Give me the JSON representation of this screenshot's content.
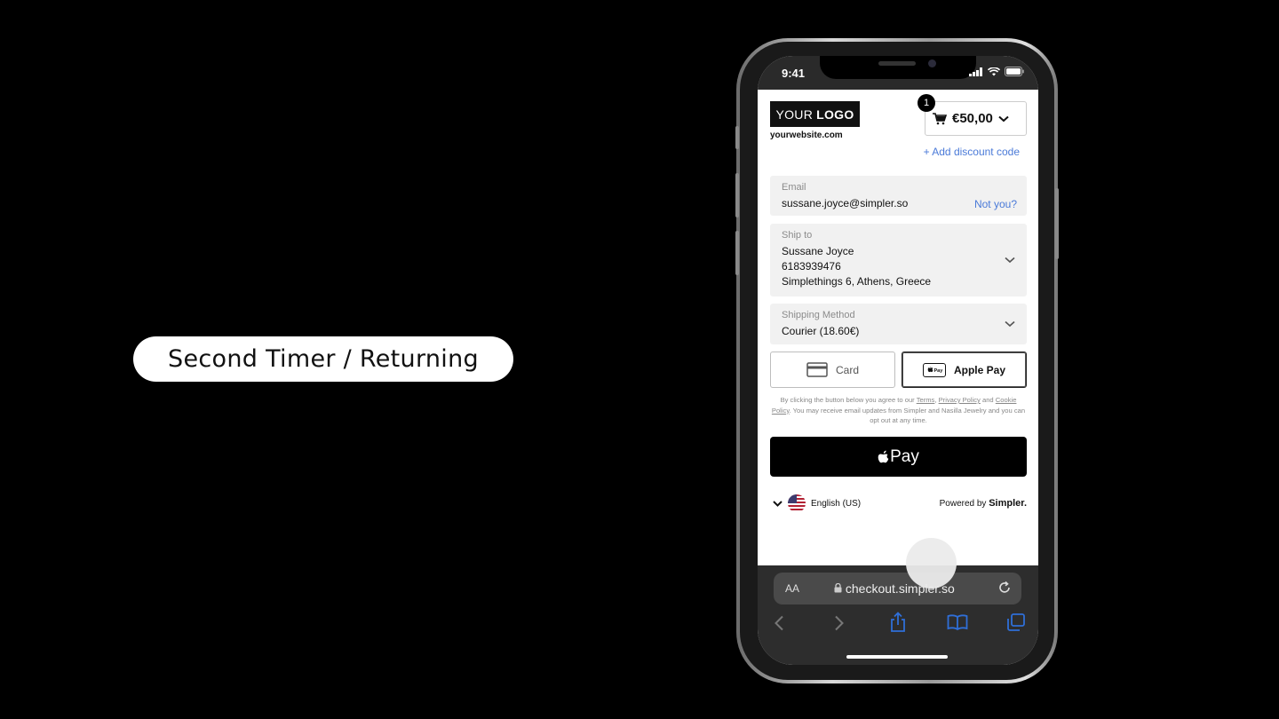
{
  "overlay": {
    "label": "Second Timer / Returning"
  },
  "status": {
    "time": "9:41"
  },
  "header": {
    "logo_plain": "YOUR",
    "logo_bold": "LOGO",
    "website": "yourwebsite.com",
    "cart_count": "1",
    "cart_total": "€50,00",
    "discount_link": "+ Add discount code"
  },
  "email": {
    "label": "Email",
    "value": "sussane.joyce@simpler.so",
    "link": "Not you?"
  },
  "ship": {
    "label": "Ship to",
    "name": "Sussane Joyce",
    "phone": "6183939476",
    "address": "Simplethings 6, Athens, Greece"
  },
  "shipping_method": {
    "label": "Shipping Method",
    "value": "Courier (18.60€)"
  },
  "payment": {
    "card_label": "Card",
    "applepay_label": "Apple Pay",
    "selected": "Apple Pay"
  },
  "legal": {
    "part1": "By clicking the button below you agree to our",
    "terms": "Terms",
    "privacy": "Privacy Policy",
    "and": "and",
    "cookie": "Cookie Policy",
    "part2": ". You may receive email updates from Simpler and Nasilla Jewelry and you can opt out at any time."
  },
  "cta": {
    "label": "Pay"
  },
  "footer": {
    "language": "English (US)",
    "powered_prefix": "Powered by",
    "powered_brand": "Simpler."
  },
  "browser": {
    "aa": "AA",
    "url": "checkout.simpler.so"
  }
}
